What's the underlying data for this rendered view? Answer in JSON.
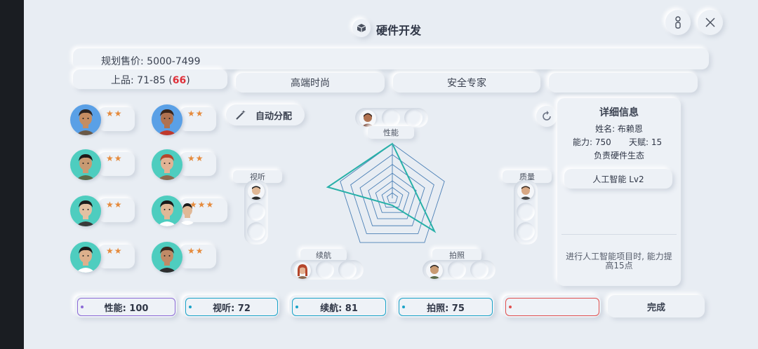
{
  "title": "硬件开发",
  "header": {
    "price_label": "规划售价: 5000-7499",
    "quality_prefix": "上品: 71-85 (",
    "quality_value": "66",
    "quality_suffix": ")",
    "tags": [
      "高端时尚",
      "安全专家",
      ""
    ]
  },
  "auto_assign_label": "自动分配",
  "staff": [
    {
      "stars": "★★",
      "skin": "#c58d62",
      "hair": "#2b2320",
      "bg": "#5aa0e6",
      "shirt": "#6b5a48"
    },
    {
      "stars": "★★",
      "skin": "#b07250",
      "hair": "#3a2418",
      "bg": "#5aa0e6",
      "shirt": "#c0392b"
    },
    {
      "stars": "★★",
      "skin": "#c89a72",
      "hair": "#1e1a18",
      "bg": "#4ecdbf",
      "shirt": "#5b6b4a"
    },
    {
      "stars": "★★",
      "skin": "#e2b394",
      "hair": "#b5462b",
      "bg": "#4ecdbf",
      "shirt": "#8c6a50"
    },
    {
      "stars": "★★",
      "skin": "#e3c1a2",
      "hair": "#1c1c1c",
      "bg": "#4ecdbf",
      "shirt": "#3a3a3a"
    },
    {
      "stars": "★★★",
      "skin": "#e0b896",
      "hair": "#1a1a1a",
      "bg": "#4ecdbf",
      "shirt": "#ffffff"
    },
    {
      "stars": "★★",
      "skin": "#ddb08c",
      "hair": "#1a1a1a",
      "bg": "#4ecdbf",
      "shirt": "#ffffff"
    },
    {
      "stars": "★★",
      "skin": "#c08a66",
      "hair": "#3a2a20",
      "bg": "#4ecdbf",
      "shirt": "#2e2e2e"
    }
  ],
  "radar": {
    "labels": {
      "performance": "性能",
      "audio": "视听",
      "quality": "质量",
      "battery": "续航",
      "camera": "拍照"
    }
  },
  "detail": {
    "title": "详细信息",
    "name": "姓名: 布赖恩",
    "ability": "能力: 750",
    "talent": "天赋: 15",
    "responsibility": "负责硬件生态",
    "skill": "人工智能  Lv2",
    "note": "进行人工智能项目时, 能力提高15点"
  },
  "stats": [
    {
      "label": "性能: 100",
      "color": "#8c6ad6"
    },
    {
      "label": "视听: 72",
      "color": "#1aa3c8"
    },
    {
      "label": "续航: 81",
      "color": "#1aa3c8"
    },
    {
      "label": "拍照: 75",
      "color": "#1aa3c8"
    },
    {
      "label": "",
      "color": "#e0504f"
    }
  ],
  "done_label": "完成",
  "colors": {
    "accent": "#27b0a8",
    "grid": "#4a7fb5",
    "stars": "#e58a3c",
    "highlight": "#e0303a"
  }
}
